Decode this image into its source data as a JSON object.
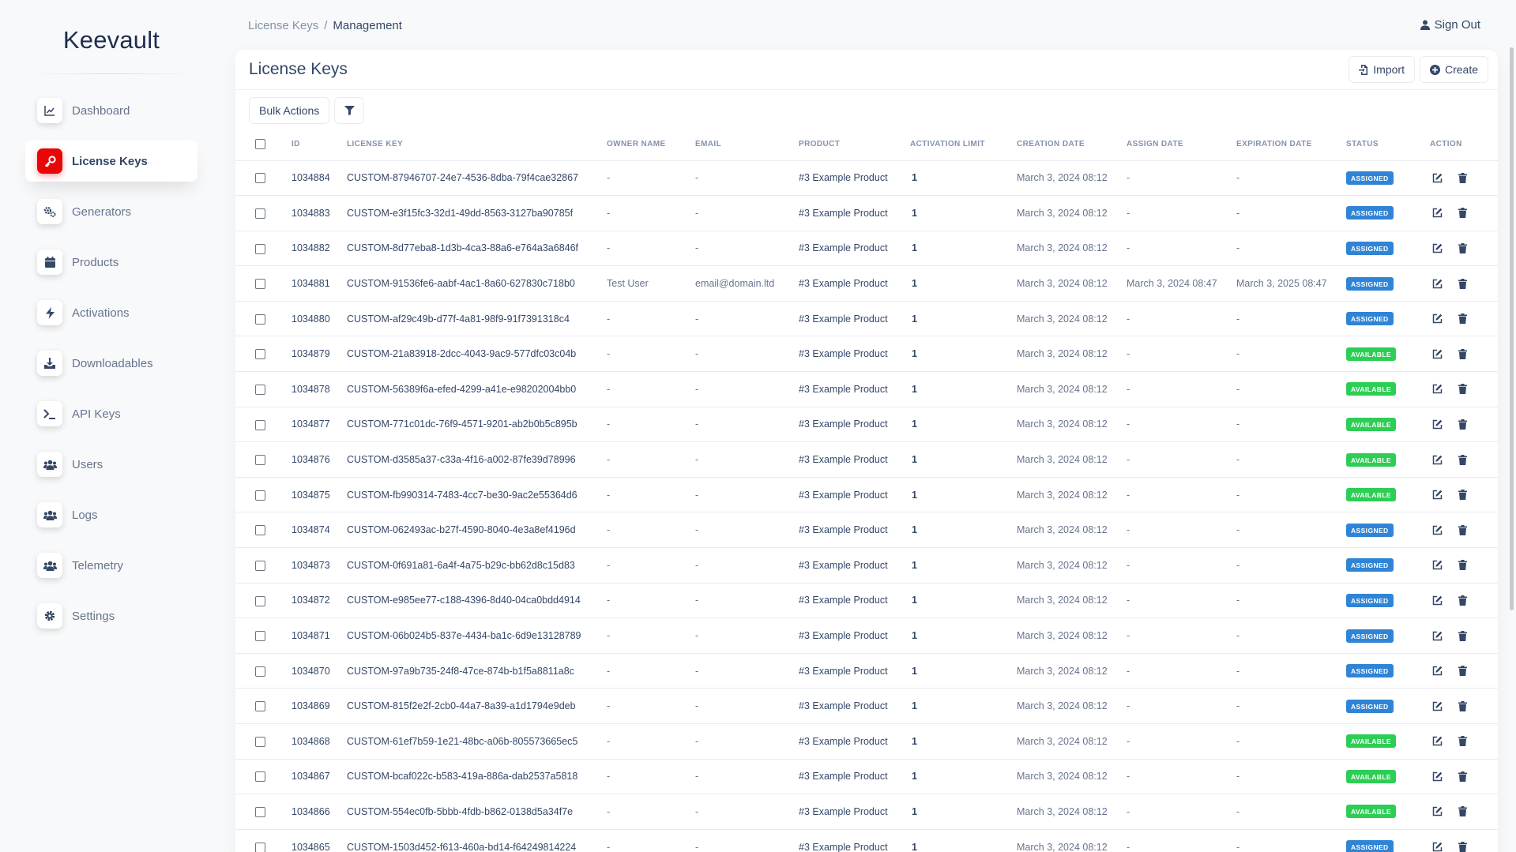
{
  "brand": "Keevault",
  "sidebar": {
    "items": [
      {
        "label": "Dashboard",
        "icon": "chart-line-icon",
        "active": false
      },
      {
        "label": "License Keys",
        "icon": "key-icon",
        "active": true
      },
      {
        "label": "Generators",
        "icon": "gears-icon",
        "active": false
      },
      {
        "label": "Products",
        "icon": "calendar-icon",
        "active": false
      },
      {
        "label": "Activations",
        "icon": "bolt-icon",
        "active": false
      },
      {
        "label": "Downloadables",
        "icon": "download-icon",
        "active": false
      },
      {
        "label": "API Keys",
        "icon": "terminal-icon",
        "active": false
      },
      {
        "label": "Users",
        "icon": "users-icon",
        "active": false
      },
      {
        "label": "Logs",
        "icon": "users-icon",
        "active": false
      },
      {
        "label": "Telemetry",
        "icon": "users-icon",
        "active": false
      },
      {
        "label": "Settings",
        "icon": "gear-icon",
        "active": false
      }
    ]
  },
  "header": {
    "breadcrumb_parent": "License Keys",
    "breadcrumb_separator": "/",
    "breadcrumb_current": "Management",
    "signout_label": "Sign Out"
  },
  "card": {
    "title": "License Keys",
    "import_label": "Import",
    "create_label": "Create",
    "bulk_actions_label": "Bulk Actions"
  },
  "table": {
    "columns": [
      "ID",
      "License Key",
      "Owner Name",
      "Email",
      "Product",
      "Activation Limit",
      "Creation Date",
      "Assign Date",
      "Expiration Date",
      "Status",
      "Action"
    ],
    "rows": [
      {
        "id": "1034884",
        "key": "CUSTOM-87946707-24e7-4536-8dba-79f4cae32867",
        "owner": "-",
        "email": "-",
        "product": "#3 Example Product",
        "limit": "1",
        "created": "March 3, 2024 08:12",
        "assigned": "-",
        "expires": "-",
        "status": "ASSIGNED"
      },
      {
        "id": "1034883",
        "key": "CUSTOM-e3f15fc3-32d1-49dd-8563-3127ba90785f",
        "owner": "-",
        "email": "-",
        "product": "#3 Example Product",
        "limit": "1",
        "created": "March 3, 2024 08:12",
        "assigned": "-",
        "expires": "-",
        "status": "ASSIGNED"
      },
      {
        "id": "1034882",
        "key": "CUSTOM-8d77eba8-1d3b-4ca3-88a6-e764a3a6846f",
        "owner": "-",
        "email": "-",
        "product": "#3 Example Product",
        "limit": "1",
        "created": "March 3, 2024 08:12",
        "assigned": "-",
        "expires": "-",
        "status": "ASSIGNED"
      },
      {
        "id": "1034881",
        "key": "CUSTOM-91536fe6-aabf-4ac1-8a60-627830c718b0",
        "owner": "Test User",
        "email": "email@domain.ltd",
        "product": "#3 Example Product",
        "limit": "1",
        "created": "March 3, 2024 08:12",
        "assigned": "March 3, 2024 08:47",
        "expires": "March 3, 2025 08:47",
        "status": "ASSIGNED"
      },
      {
        "id": "1034880",
        "key": "CUSTOM-af29c49b-d77f-4a81-98f9-91f7391318c4",
        "owner": "-",
        "email": "-",
        "product": "#3 Example Product",
        "limit": "1",
        "created": "March 3, 2024 08:12",
        "assigned": "-",
        "expires": "-",
        "status": "ASSIGNED"
      },
      {
        "id": "1034879",
        "key": "CUSTOM-21a83918-2dcc-4043-9ac9-577dfc03c04b",
        "owner": "-",
        "email": "-",
        "product": "#3 Example Product",
        "limit": "1",
        "created": "March 3, 2024 08:12",
        "assigned": "-",
        "expires": "-",
        "status": "AVAILABLE"
      },
      {
        "id": "1034878",
        "key": "CUSTOM-56389f6a-efed-4299-a41e-e98202004bb0",
        "owner": "-",
        "email": "-",
        "product": "#3 Example Product",
        "limit": "1",
        "created": "March 3, 2024 08:12",
        "assigned": "-",
        "expires": "-",
        "status": "AVAILABLE"
      },
      {
        "id": "1034877",
        "key": "CUSTOM-771c01dc-76f9-4571-9201-ab2b0b5c895b",
        "owner": "-",
        "email": "-",
        "product": "#3 Example Product",
        "limit": "1",
        "created": "March 3, 2024 08:12",
        "assigned": "-",
        "expires": "-",
        "status": "AVAILABLE"
      },
      {
        "id": "1034876",
        "key": "CUSTOM-d3585a37-c33a-4f16-a002-87fe39d78996",
        "owner": "-",
        "email": "-",
        "product": "#3 Example Product",
        "limit": "1",
        "created": "March 3, 2024 08:12",
        "assigned": "-",
        "expires": "-",
        "status": "AVAILABLE"
      },
      {
        "id": "1034875",
        "key": "CUSTOM-fb990314-7483-4cc7-be30-9ac2e55364d6",
        "owner": "-",
        "email": "-",
        "product": "#3 Example Product",
        "limit": "1",
        "created": "March 3, 2024 08:12",
        "assigned": "-",
        "expires": "-",
        "status": "AVAILABLE"
      },
      {
        "id": "1034874",
        "key": "CUSTOM-062493ac-b27f-4590-8040-4e3a8ef4196d",
        "owner": "-",
        "email": "-",
        "product": "#3 Example Product",
        "limit": "1",
        "created": "March 3, 2024 08:12",
        "assigned": "-",
        "expires": "-",
        "status": "ASSIGNED"
      },
      {
        "id": "1034873",
        "key": "CUSTOM-0f691a81-6a4f-4a75-b29c-bb62d8c15d83",
        "owner": "-",
        "email": "-",
        "product": "#3 Example Product",
        "limit": "1",
        "created": "March 3, 2024 08:12",
        "assigned": "-",
        "expires": "-",
        "status": "ASSIGNED"
      },
      {
        "id": "1034872",
        "key": "CUSTOM-e985ee77-c188-4396-8d40-04ca0bdd4914",
        "owner": "-",
        "email": "-",
        "product": "#3 Example Product",
        "limit": "1",
        "created": "March 3, 2024 08:12",
        "assigned": "-",
        "expires": "-",
        "status": "ASSIGNED"
      },
      {
        "id": "1034871",
        "key": "CUSTOM-06b024b5-837e-4434-ba1c-6d9e13128789",
        "owner": "-",
        "email": "-",
        "product": "#3 Example Product",
        "limit": "1",
        "created": "March 3, 2024 08:12",
        "assigned": "-",
        "expires": "-",
        "status": "ASSIGNED"
      },
      {
        "id": "1034870",
        "key": "CUSTOM-97a9b735-24f8-47ce-874b-b1f5a8811a8c",
        "owner": "-",
        "email": "-",
        "product": "#3 Example Product",
        "limit": "1",
        "created": "March 3, 2024 08:12",
        "assigned": "-",
        "expires": "-",
        "status": "ASSIGNED"
      },
      {
        "id": "1034869",
        "key": "CUSTOM-815f2e2f-2cb0-44a7-8a39-a1d1794e9deb",
        "owner": "-",
        "email": "-",
        "product": "#3 Example Product",
        "limit": "1",
        "created": "March 3, 2024 08:12",
        "assigned": "-",
        "expires": "-",
        "status": "ASSIGNED"
      },
      {
        "id": "1034868",
        "key": "CUSTOM-61ef7b59-1e21-48bc-a06b-805573665ec5",
        "owner": "-",
        "email": "-",
        "product": "#3 Example Product",
        "limit": "1",
        "created": "March 3, 2024 08:12",
        "assigned": "-",
        "expires": "-",
        "status": "AVAILABLE"
      },
      {
        "id": "1034867",
        "key": "CUSTOM-bcaf022c-b583-419a-886a-dab2537a5818",
        "owner": "-",
        "email": "-",
        "product": "#3 Example Product",
        "limit": "1",
        "created": "March 3, 2024 08:12",
        "assigned": "-",
        "expires": "-",
        "status": "AVAILABLE"
      },
      {
        "id": "1034866",
        "key": "CUSTOM-554ec0fb-5bbb-4fdb-b862-0138d5a34f7e",
        "owner": "-",
        "email": "-",
        "product": "#3 Example Product",
        "limit": "1",
        "created": "March 3, 2024 08:12",
        "assigned": "-",
        "expires": "-",
        "status": "AVAILABLE"
      },
      {
        "id": "1034865",
        "key": "CUSTOM-1503d452-f613-460a-bd14-f64249814224",
        "owner": "-",
        "email": "-",
        "product": "#3 Example Product",
        "limit": "1",
        "created": "March 3, 2024 08:12",
        "assigned": "-",
        "expires": "-",
        "status": "ASSIGNED"
      }
    ]
  },
  "colors": {
    "accent": "#ea0606",
    "assigned_badge": "#3084d6",
    "available_badge": "#2dce55",
    "text_primary": "#344767",
    "text_secondary": "#67748e"
  }
}
